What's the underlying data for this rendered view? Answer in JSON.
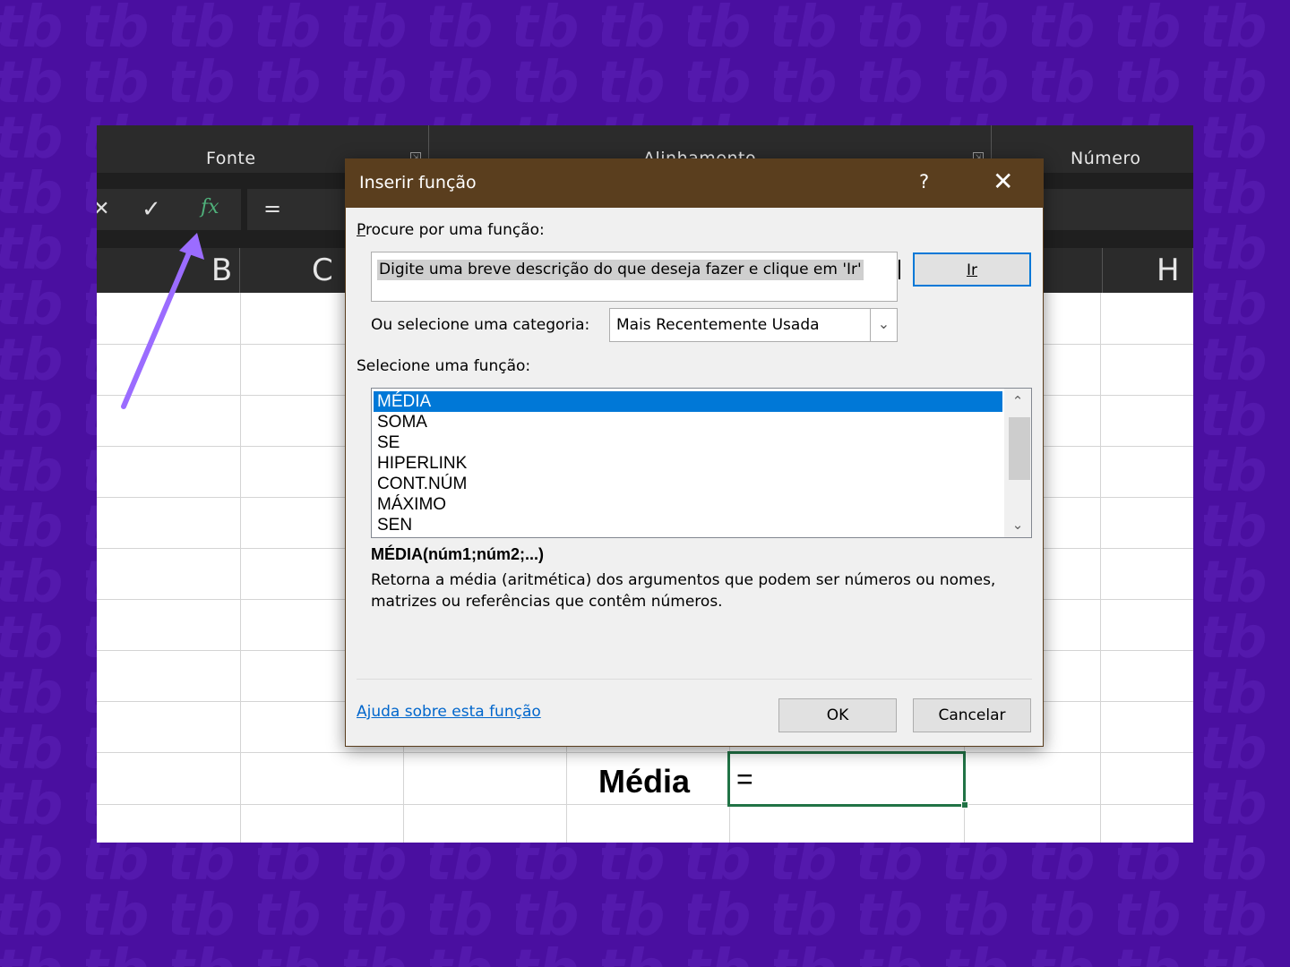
{
  "ribbon": {
    "groups": [
      "Fonte",
      "Alinhamento",
      "Número"
    ],
    "launcher_glyph": "⇲"
  },
  "formula_bar": {
    "cancel_glyph": "✕",
    "enter_glyph": "✓",
    "fx_label": "fx",
    "content": "="
  },
  "columns": [
    "B",
    "C",
    "H"
  ],
  "sheet": {
    "label_cell": "Média",
    "active_cell_content": "="
  },
  "dialog": {
    "title": "Inserir função",
    "help_glyph": "?",
    "close_glyph": "✕",
    "search_label": "Procure por uma função:",
    "search_value": "Digite uma breve descrição do que deseja fazer e clique em 'Ir'",
    "go_button": "Ir",
    "category_label": "Ou selecione uma categoria:",
    "category_value": "Mais Recentemente Usada",
    "function_list_label": "Selecione uma função:",
    "functions": [
      "MÉDIA",
      "SOMA",
      "SE",
      "HIPERLINK",
      "CONT.NÚM",
      "MÁXIMO",
      "SEN"
    ],
    "selected_function": "MÉDIA",
    "signature": "MÉDIA(núm1;núm2;...)",
    "description": "Retorna a média (aritmética) dos argumentos que podem ser números ou nomes, matrizes ou referências que contêm números.",
    "help_link": "Ajuda sobre esta função",
    "ok_button": "OK",
    "cancel_button": "Cancelar"
  },
  "colors": {
    "background": "#4a0fa0",
    "titlebar": "#5a3e1e",
    "selection": "#0078d7",
    "excel_green": "#217346",
    "arrow": "#9b6cff"
  }
}
